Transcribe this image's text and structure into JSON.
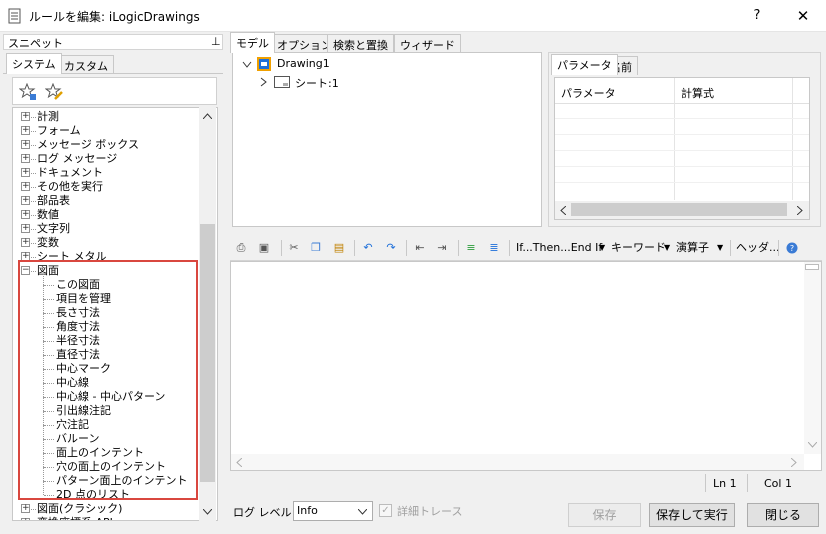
{
  "window": {
    "title": "ルールを編集: iLogicDrawings",
    "help_label": "?",
    "close_label": "✕"
  },
  "snippets": {
    "header": "スニペット",
    "pin_icon": "⊥",
    "tabs": [
      "システム",
      "カスタム"
    ],
    "tree": [
      {
        "label": "計測",
        "expanded": false
      },
      {
        "label": "フォーム",
        "expanded": false
      },
      {
        "label": "メッセージ ボックス",
        "expanded": false
      },
      {
        "label": "ログ メッセージ",
        "expanded": false
      },
      {
        "label": "ドキュメント",
        "expanded": false
      },
      {
        "label": "その他を実行",
        "expanded": false
      },
      {
        "label": "部品表",
        "expanded": false
      },
      {
        "label": "数値",
        "expanded": false
      },
      {
        "label": "文字列",
        "expanded": false
      },
      {
        "label": "変数",
        "expanded": false
      },
      {
        "label": "シート メタル",
        "expanded": false
      },
      {
        "label": "図面",
        "expanded": true
      },
      {
        "label": "この図面",
        "child": true
      },
      {
        "label": "項目を管理",
        "child": true
      },
      {
        "label": "長さ寸法",
        "child": true
      },
      {
        "label": "角度寸法",
        "child": true
      },
      {
        "label": "半径寸法",
        "child": true
      },
      {
        "label": "直径寸法",
        "child": true
      },
      {
        "label": "中心マーク",
        "child": true
      },
      {
        "label": "中心線",
        "child": true
      },
      {
        "label": "中心線 - 中心パターン",
        "child": true
      },
      {
        "label": "引出線注記",
        "child": true
      },
      {
        "label": "穴注記",
        "child": true
      },
      {
        "label": "バルーン",
        "child": true
      },
      {
        "label": "面上のインテント",
        "child": true
      },
      {
        "label": "穴の面上のインテント",
        "child": true
      },
      {
        "label": "パターン面上のインテント",
        "child": true
      },
      {
        "label": "2D 点のリスト",
        "child": true
      },
      {
        "label": "図面(クラシック)",
        "expanded": false
      },
      {
        "label": "変換座標系 API",
        "expanded": false
      }
    ]
  },
  "main_tabs": [
    "モデル",
    "オプション",
    "検索と置換",
    "ウィザード"
  ],
  "model_tree": {
    "root": "Drawing1",
    "child": "シート:1"
  },
  "params": {
    "tabs": [
      "パラメータ",
      "名前"
    ],
    "columns": [
      "パラメータ",
      "計算式"
    ]
  },
  "toolbar": {
    "if_then": "If...Then...End If",
    "keyword": "キーワード",
    "operator": "演算子",
    "header": "ヘッダ..."
  },
  "status": {
    "ln": "Ln 1",
    "col": "Col 1"
  },
  "bottom": {
    "log_level_label": "ログ レベル",
    "log_level_value": "Info",
    "trace_label": "詳細トレース",
    "save": "保存",
    "save_run": "保存して実行",
    "close": "閉じる"
  },
  "colors": {
    "highlight_box": "#d9473f",
    "accent": "#1e6fd9"
  }
}
